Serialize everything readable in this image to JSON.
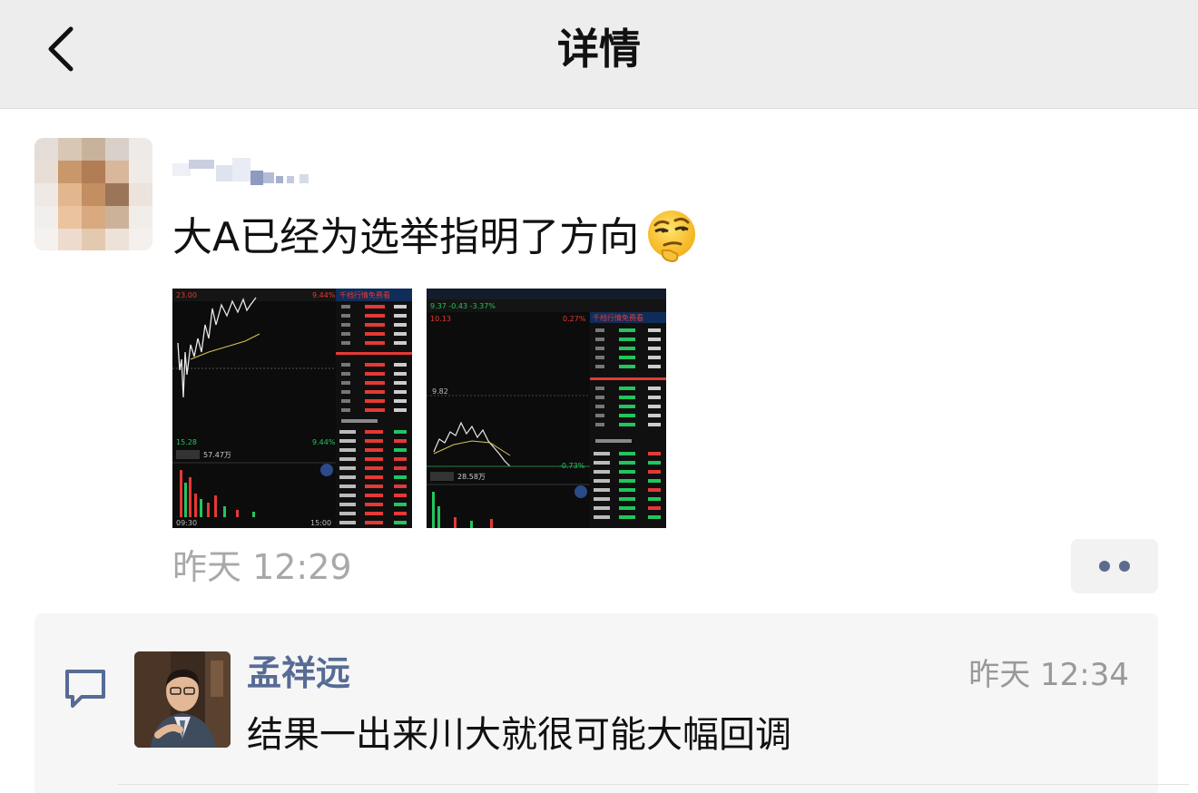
{
  "header": {
    "title": "详情",
    "back_icon": "chevron-left-icon"
  },
  "post": {
    "text": "大A已经为选举指明了方向",
    "emoji": "smirk-thinking-emoji",
    "images": [
      {
        "content": "stock-chart-screenshot-1",
        "title_text": "千档行情免费看",
        "time_start": "09:30",
        "time_end": "15:00"
      },
      {
        "content": "stock-chart-screenshot-2",
        "title_text": "千档行情免费看"
      }
    ],
    "timestamp": "昨天 12:29",
    "more_icon": "more-dots-icon"
  },
  "comments": [
    {
      "author": "孟祥远",
      "time": "昨天 12:34",
      "text": "结果一出来川大就很可能大幅回调",
      "icon": "comment-bubble-icon"
    }
  ],
  "colors": {
    "navbar_bg": "#ededed",
    "link_blue": "#576b95",
    "muted": "#a8a8a8",
    "chart_red": "#e53935",
    "chart_green": "#22c55e"
  }
}
